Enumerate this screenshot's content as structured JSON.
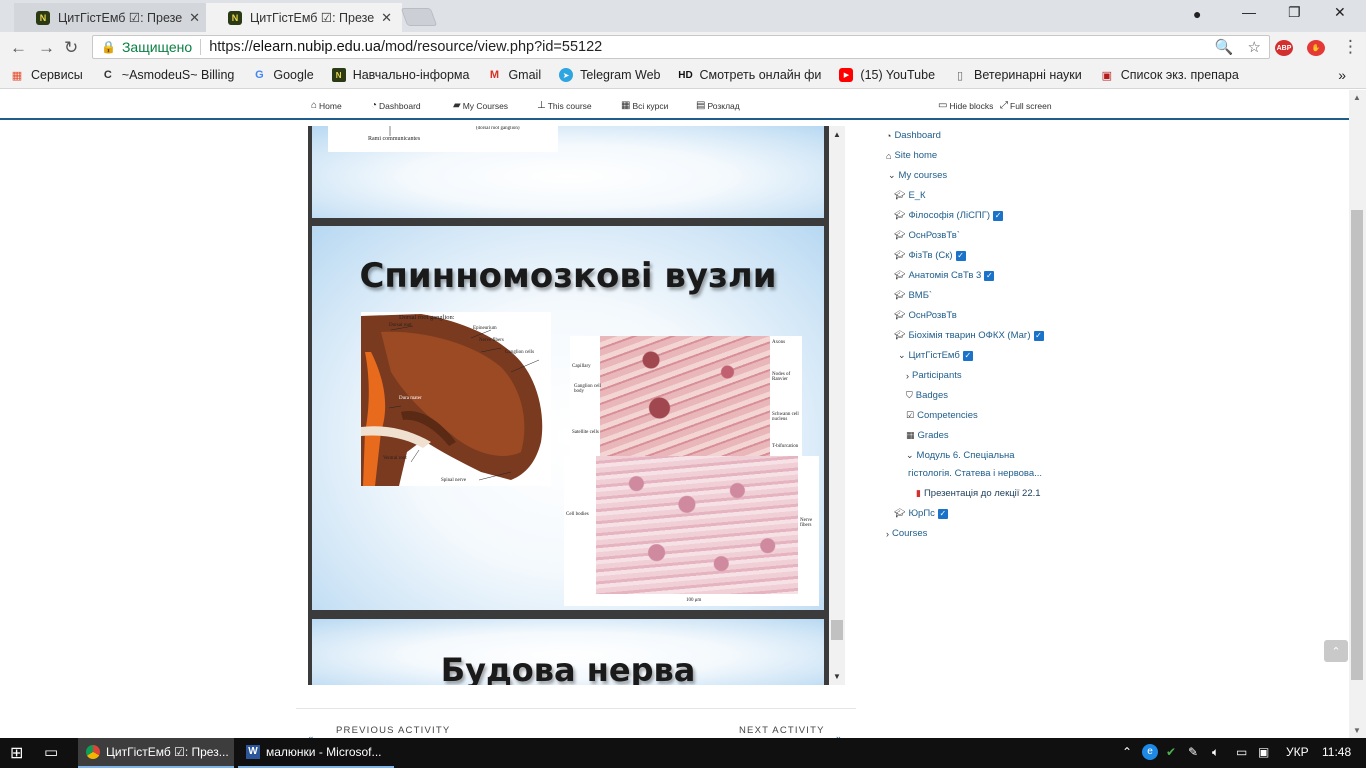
{
  "browser": {
    "tabs": [
      {
        "title": "ЦитГістЕмб ☑: Презент",
        "active": false
      },
      {
        "title": "ЦитГістЕмб ☑: Презент",
        "active": true
      }
    ],
    "window_controls": [
      "—",
      "❐",
      "✕"
    ],
    "secure_label": "Защищено",
    "url_scheme": "https://",
    "url_host": "elearn.nubip.edu.ua",
    "url_path": "/mod/resource/view.php?id=55122",
    "bookmarks": [
      {
        "label": "Сервисы",
        "icon": "apps-grid-icon",
        "color": "#e34b2d"
      },
      {
        "label": "~AsmodeuS~ Billing",
        "icon": "c-icon",
        "color": "#333333"
      },
      {
        "label": "Google",
        "icon": "google-icon",
        "color": "#4285f4"
      },
      {
        "label": "Навчально-інформа",
        "icon": "nubip-icon",
        "color": "#2b3a14"
      },
      {
        "label": "Gmail",
        "icon": "gmail-icon",
        "color": "#d93025"
      },
      {
        "label": "Telegram Web",
        "icon": "telegram-icon",
        "color": "#2ca5e0"
      },
      {
        "label": "Смотреть онлайн фи",
        "icon": "hd-icon",
        "color": "#111111"
      },
      {
        "label": "(15) YouTube",
        "icon": "youtube-icon",
        "color": "#ff0000"
      },
      {
        "label": "Ветеринарні науки",
        "icon": "page-icon",
        "color": "#666666"
      },
      {
        "label": "Список экз. препара",
        "icon": "doc-icon",
        "color": "#b71c1c"
      }
    ],
    "bookmarks_more": "»"
  },
  "moodle_nav": {
    "home": "Home",
    "dashboard": "Dashboard",
    "my_courses": "My Courses",
    "this_course": "This course",
    "all_courses": "Всі курси",
    "schedule": "Розклад",
    "hide_blocks": "Hide blocks",
    "full_screen": "Full screen"
  },
  "presentation": {
    "prev_slide_caption": "Rami communicantes",
    "prev_slide_caption2": "(dorsal root ganglion)",
    "slide1_title": "Спинномозкові вузли",
    "slide2_title": "Будова нерва",
    "image1": {
      "heading": "Dorsal root ganglion:",
      "labels": {
        "dorsal_root": "Dorsal root",
        "epineurium": "Epineurium",
        "nerve_fibers": "Nerve fibers",
        "ganglion_cells": "Ganglion cells",
        "dura_mater": "Dura mater",
        "ventral_root": "Ventral root",
        "spinal_nerve": "Spinal nerve"
      }
    },
    "image2": {
      "labels": {
        "capillary": "Capillary",
        "axons": "Axons",
        "ganglion_cell_body": "Ganglion cell body",
        "nodes_of_ranvier": "Nodes of Ranvier",
        "schwann_cell_nucleus": "Schwann cell nucleus",
        "satellite_cells": "Satellite cells",
        "t_bifurcation": "T-bifurcation"
      }
    },
    "image3": {
      "labels": {
        "cell_bodies": "Cell bodies",
        "nerve_fibers": "Nerve fibers",
        "scale": "100 μm"
      }
    }
  },
  "activity_nav": {
    "previous": "PREVIOUS ACTIVITY",
    "next": "NEXT ACTIVITY"
  },
  "sidebar": {
    "dashboard": "Dashboard",
    "site_home": "Site home",
    "my_courses": "My courses",
    "courses": [
      {
        "label": "Е_К",
        "checked": false
      },
      {
        "label": "Філософія (ЛіСПГ)",
        "checked": true
      },
      {
        "label": "ОснРозвТв`",
        "checked": false
      },
      {
        "label": "ФізТв (Ск)",
        "checked": true
      },
      {
        "label": "Анатомія СвТв 3",
        "checked": true
      },
      {
        "label": "ВМБ`",
        "checked": false
      },
      {
        "label": "ОснРозвТв",
        "checked": false
      },
      {
        "label": "Біохімія тварин ОФКХ (Маг)",
        "checked": true
      }
    ],
    "current_course": "ЦитГістЕмб",
    "participants": "Participants",
    "badges": "Badges",
    "competencies": "Competencies",
    "grades": "Grades",
    "module_line1": "Модуль 6. Спеціальна",
    "module_line2": "гістологія. Статева і нервова...",
    "resource": "Презентація до лекції 22.1",
    "last_course": "ЮрПс",
    "courses_node": "Courses"
  },
  "taskbar": {
    "items": [
      {
        "label": "ЦитГістЕмб ☑: През...",
        "icon": "chrome-icon",
        "active": true
      },
      {
        "label": "малюнки - Microsof...",
        "icon": "word-icon",
        "active": false
      }
    ],
    "language": "УКР",
    "time": "11:48"
  }
}
